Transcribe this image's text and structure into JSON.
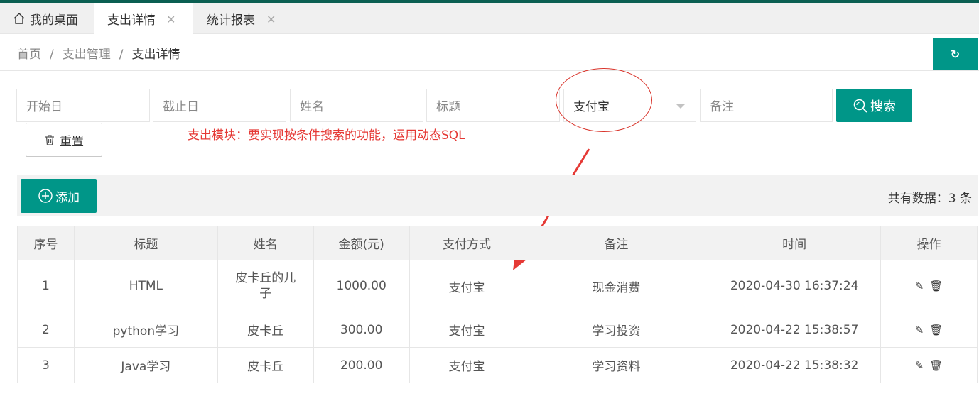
{
  "tabs": {
    "home": "我的桌面",
    "items": [
      {
        "label": "支出详情",
        "close": "✕"
      },
      {
        "label": "统计报表",
        "close": "✕"
      }
    ]
  },
  "breadcrumb": {
    "items": [
      "首页",
      "支出管理",
      "支出详情"
    ],
    "sep": "/"
  },
  "refresh_label": "↻",
  "filters": {
    "start_placeholder": "开始日",
    "end_placeholder": "截止日",
    "name_placeholder": "姓名",
    "title_placeholder": "标题",
    "pay_method_value": "支付宝",
    "note_placeholder": "备注",
    "search_label": "搜索",
    "reset_label": "重置"
  },
  "annotation": "支出模块：要实现按条件搜索的功能，运用动态SQL",
  "toolbar": {
    "add_label": "添加",
    "total_text": "共有数据：3 条"
  },
  "table": {
    "headers": [
      "序号",
      "标题",
      "姓名",
      "金额(元)",
      "支付方式",
      "备注",
      "时间",
      "操作"
    ],
    "rows": [
      [
        "1",
        "HTML",
        "皮卡丘的儿子",
        "1000.00",
        "支付宝",
        "现金消费",
        "2020-04-30 16:37:24"
      ],
      [
        "2",
        "python学习",
        "皮卡丘",
        "300.00",
        "支付宝",
        "学习投资",
        "2020-04-22 15:38:57"
      ],
      [
        "3",
        "Java学习",
        "皮卡丘",
        "200.00",
        "支付宝",
        "学习资料",
        "2020-04-22 15:38:32"
      ]
    ]
  },
  "colors": {
    "accent": "#009688",
    "annotation": "#e53935"
  }
}
